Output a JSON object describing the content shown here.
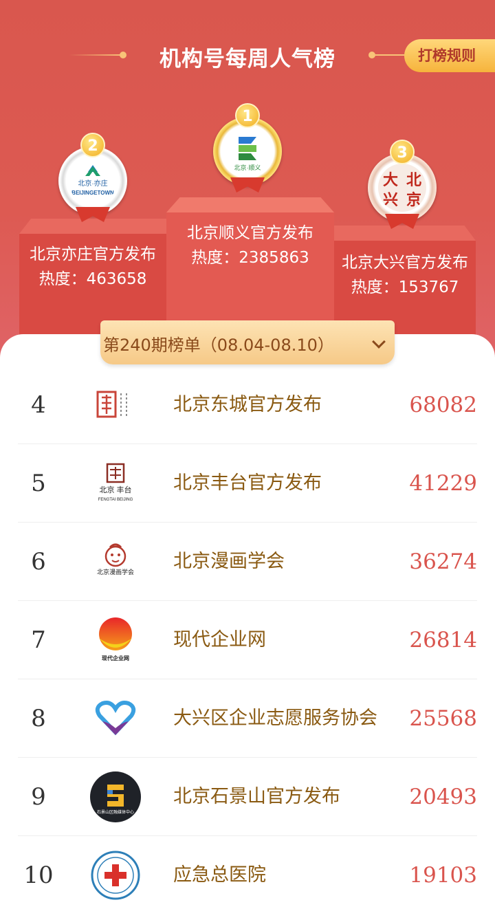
{
  "header": {
    "title": "机构号每周人气榜",
    "rules_button": "打榜规则"
  },
  "podium": [
    {
      "rank": "2",
      "name": "北京亦庄官方发布",
      "heat": "热度：463658",
      "logo_text": "北京·亦庄",
      "logo_sub": "BEIJINGETOWN"
    },
    {
      "rank": "1",
      "name": "北京顺义官方发布",
      "heat": "热度：2385863",
      "logo_text": "北京·顺义"
    },
    {
      "rank": "3",
      "name": "北京大兴官方发布",
      "heat": "热度：153767",
      "logo_chars": [
        "大",
        "北",
        "兴",
        "京"
      ]
    }
  ],
  "period": {
    "label": "第240期榜单（08.04-08.10）"
  },
  "ranking": [
    {
      "rank": "4",
      "name": "北京东城官方发布",
      "heat": "68082"
    },
    {
      "rank": "5",
      "name": "北京丰台官方发布",
      "heat": "41229",
      "logo_text": "北京 丰台",
      "logo_sub": "FENGTAI BEIJING"
    },
    {
      "rank": "6",
      "name": "北京漫画学会",
      "heat": "36274",
      "logo_text": "北京漫画学会"
    },
    {
      "rank": "7",
      "name": "现代企业网",
      "heat": "26814",
      "logo_text": "现代企业网"
    },
    {
      "rank": "8",
      "name": "大兴区企业志愿服务协会",
      "heat": "25568"
    },
    {
      "rank": "9",
      "name": "北京石景山官方发布",
      "heat": "20493",
      "logo_text": "石景山区融媒体中心"
    },
    {
      "rank": "10",
      "name": "应急总医院",
      "heat": "19103"
    }
  ],
  "colors": {
    "hero_red": "#dd5a52",
    "gold": "#f6b43c",
    "heat_red": "#d9544d",
    "name_brown": "#8a5a12"
  }
}
